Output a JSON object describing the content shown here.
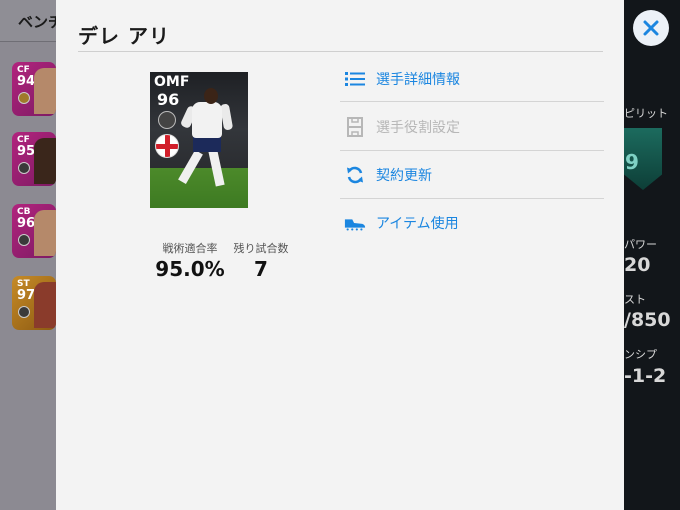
{
  "modal": {
    "title": "デレ アリ",
    "player_card": {
      "position": "OMF",
      "rating": "96"
    },
    "stats": [
      {
        "label": "戦術適合率",
        "value": "95.0%"
      },
      {
        "label": "残り試合数",
        "value": "7"
      }
    ],
    "menu": [
      {
        "label": "選手詳細情報",
        "icon": "list-icon",
        "enabled": true
      },
      {
        "label": "選手役割設定",
        "icon": "formation-icon",
        "enabled": false
      },
      {
        "label": "契約更新",
        "icon": "refresh-icon",
        "enabled": true
      },
      {
        "label": "アイテム使用",
        "icon": "boot-icon",
        "enabled": true
      }
    ],
    "close_icon": "close-icon"
  },
  "background": {
    "left_title": "ベンチ",
    "cards": [
      {
        "position": "CF",
        "rating": "94"
      },
      {
        "position": "CF",
        "rating": "95"
      },
      {
        "position": "CB",
        "rating": "96"
      },
      {
        "position": "ST",
        "rating": "97"
      }
    ],
    "right_texts": [
      "ピリット",
      "パワー",
      "20",
      "スト",
      "/850",
      "ンシプ",
      "-1-2"
    ],
    "right_shield_value": "9"
  },
  "colors": {
    "accent": "#1b86e0",
    "disabled": "#b7b7b7",
    "modal_bg": "#f3f3f3"
  }
}
